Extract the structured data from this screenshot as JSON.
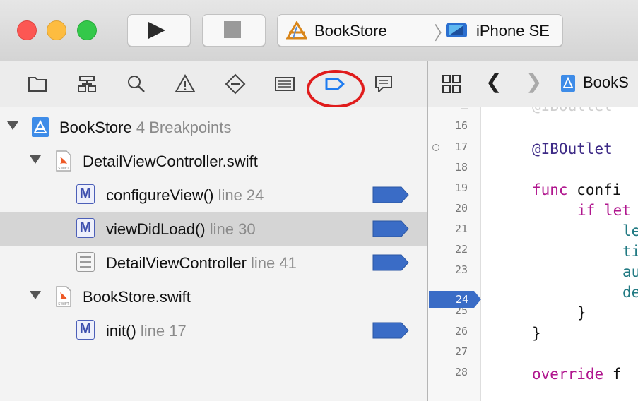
{
  "toolbar": {
    "scheme_name": "BookStore",
    "separator": "〉",
    "device_name": "iPhone SE"
  },
  "navigator_tabs": [
    "project-navigator-icon",
    "symbol-navigator-icon",
    "find-navigator-icon",
    "issue-navigator-icon",
    "test-navigator-icon",
    "debug-navigator-icon",
    "breakpoint-navigator-icon",
    "report-navigator-icon"
  ],
  "breakpoints": {
    "project": {
      "name": "BookStore",
      "detail": "4 Breakpoints"
    },
    "files": [
      {
        "name": "DetailViewController.swift",
        "items": [
          {
            "name": "configureView()",
            "detail": "line 24"
          },
          {
            "name": "viewDidLoad()",
            "detail": "line 30"
          },
          {
            "name": "DetailViewController",
            "detail": "line 41"
          }
        ]
      },
      {
        "name": "BookStore.swift",
        "items": [
          {
            "name": "init()",
            "detail": "line 17"
          }
        ]
      }
    ]
  },
  "editor": {
    "jump_bar_file": "BookS",
    "line_numbers": [
      "16",
      "17",
      "18",
      "19",
      "20",
      "21",
      "22",
      "23",
      "24",
      "25",
      "26",
      "27",
      "28"
    ],
    "active_line": "24",
    "code": {
      "top_fragment": "@IBOutlet",
      "l17": "@IBOutlet",
      "l19_kw": "func",
      "l19_rest": "confi",
      "l20_kw": "if let",
      "l21": "le",
      "l22": "ti",
      "l23": "au",
      "l24": "de",
      "l25": "}",
      "l26": "}",
      "l28_kw": "override",
      "l28_rest": "f"
    }
  },
  "colors": {
    "breakpoint_blue": "#3a6cc6",
    "highlight_red": "#e01c1c",
    "keyword": "#b0168e"
  }
}
